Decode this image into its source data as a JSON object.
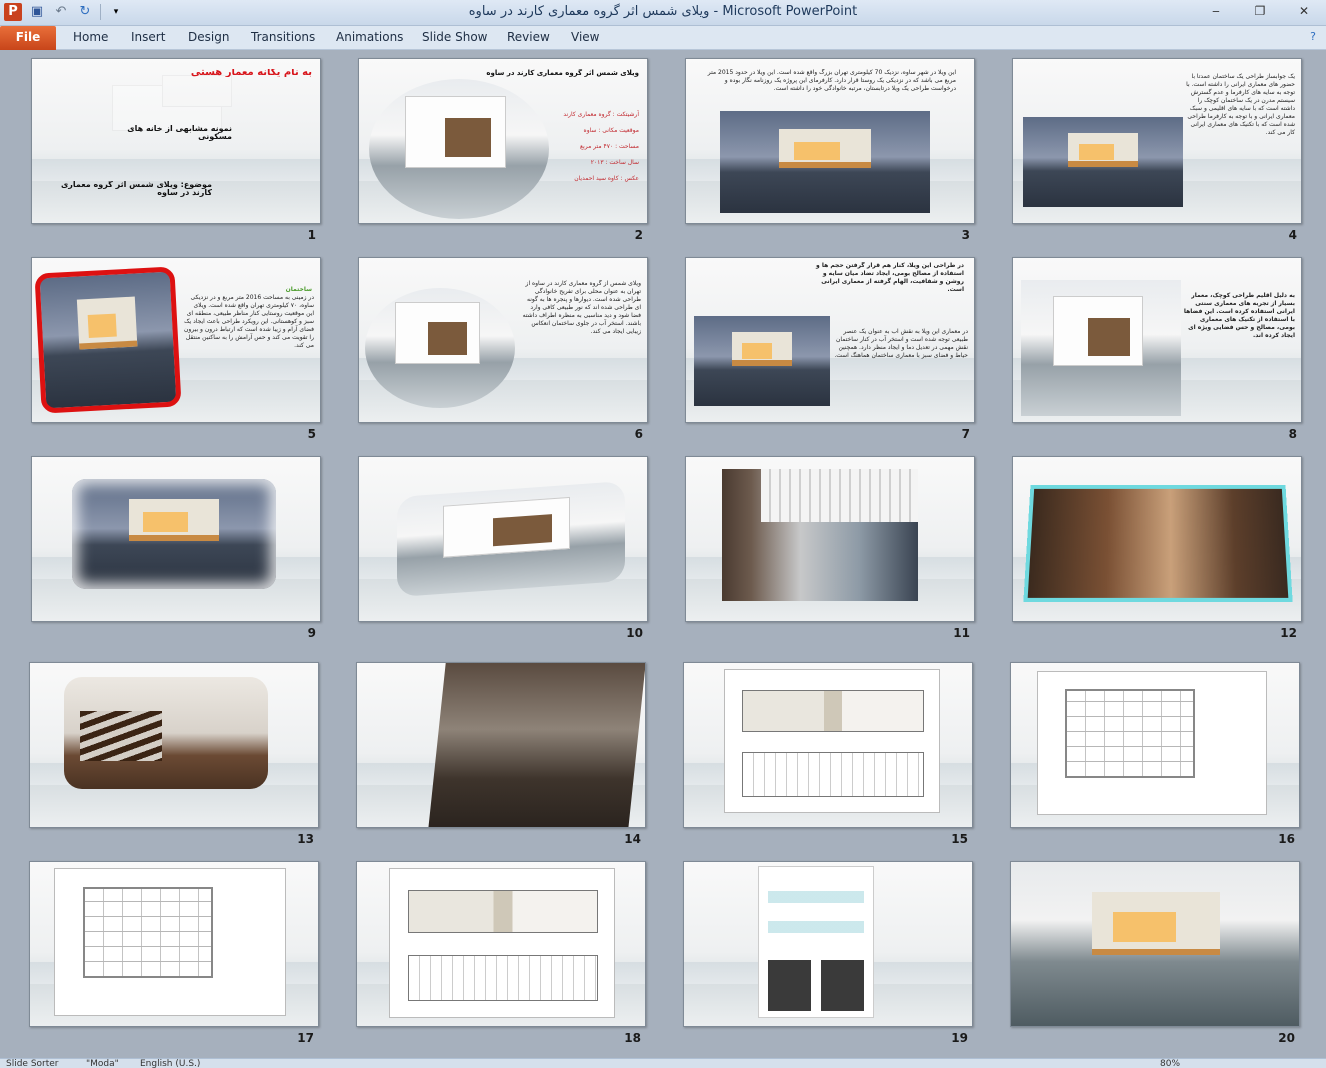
{
  "window": {
    "title": "ویلای شمس اثر گروه معماری کارند در ساوه  -  Microsoft PowerPoint",
    "app_icon": "P",
    "controls": [
      "‒",
      "❐",
      "✕"
    ]
  },
  "ribbon": {
    "file_tab": "File",
    "tabs": [
      "Home",
      "Insert",
      "Design",
      "Transitions",
      "Animations",
      "Slide Show",
      "Review",
      "View"
    ]
  },
  "slides": {
    "s1": {
      "number": "1",
      "heading": "به نام یگانه معمار هستی",
      "subtitle": "نمونه مشابهی از خانه های مسکونی",
      "topic": "موضوع: ویلای شمس اثر گروه معماری کارند در ساوه"
    },
    "s2": {
      "number": "2",
      "title": "ویلای شمس اثر گروه معماری کارند در ساوه",
      "details": [
        "آرشیتکت : گروه معماری کارند",
        "موقعیت مکانی : ساوه",
        "مساحت : ۴۷۰ متر مربع",
        "سال ساخت : ۲۰۱۳",
        "عکس : کاوه سید احمدیان"
      ]
    },
    "s3": {
      "number": "3",
      "text": "این ویلا در شهر ساوه، نزدیک 70 کیلومتری تهران بزرگ واقع شده است. این ویلا در حدود 2015 متر مربع می باشد که در نزدیکی یک روستا قرار دارد. کارفرمای این پروژه یک روزنامه نگار بوده و درخواست طراحی یک ویلا درتابستان، مرتبه خانوادگی خود را داشته است."
    },
    "s4": {
      "number": "4",
      "text": "یک جوابساز طراحی یک ساختمان عمدتاً با حضور های معماری ایرانی را داشته است. با توجه به سایه های کارفرما و عدم گسترش سیستم مدرن در یک ساختمان کوچک را داشته است که با سایه های اقلیمی و سبک معماری ایرانی و با توجه به کارفرما طراحی شده است که با تکنیک های معماری ایرانی کار می کند."
    },
    "s5": {
      "number": "5",
      "highlight": "ساختمان",
      "text": "در زمینی به مساحت 2016 متر مربع و در نزدیکی ساوه، ۷۰ کیلومتری تهران واقع شده است. ویلای این موقعیت روستایی کنار مناظر طبیعی، منطقه ای سبز و کوهستانی. این رویکرد طراحی باعث ایجاد یک فضای آرام و زیبا شده است که ارتباط درون و بیرون را تقویت می کند و حس آرامش را به ساکنین منتقل می کند."
    },
    "s6": {
      "number": "6",
      "text": "ویلای شمس از گروه معماری کارند در ساوه از تهران به عنوان محلی برای تفریح خانوادگی طراحی شده است. دیوارها و پنجره ها به گونه ای طراحی شده اند که نور طبیعی کافی وارد فضا شود و دید مناسبی به منظره اطراف داشته باشند. استخر آب در جلوی ساختمان انعکاس زیبایی ایجاد می کند."
    },
    "s7": {
      "number": "7",
      "text_top": "در طراحی این ویلا، کنار هم قرار گرفتن حجم ها و استفاده از مصالح بومی، ایجاد تضاد میان سایه و روشن و شفافیت، الهام گرفته از معماری ایرانی است.",
      "text_bottom": "در معماری این ویلا به نقش آب به عنوان یک عنصر طبیعی توجه شده است و استخر آب در کنار ساختمان نقش مهمی در تعدیل دما و ایجاد منظر دارد. همچنین حیاط و فضای سبز با معماری ساختمان هماهنگ است."
    },
    "s8": {
      "number": "8",
      "text": "به دلیل اقلیم طراحی کوچک، معمار بسیار از تجربه های معماری سنتی ایرانی استفاده کرده است. این فضاها با استفاده از تکنیک های معماری بومی، مصالح و حس فضایی ویژه ای ایجاد کرده اند."
    },
    "s9": {
      "number": "9"
    },
    "s10": {
      "number": "10"
    },
    "s11": {
      "number": "11"
    },
    "s12": {
      "number": "12"
    },
    "s13": {
      "number": "13"
    },
    "s14": {
      "number": "14"
    },
    "s15": {
      "number": "15"
    },
    "s16": {
      "number": "16"
    },
    "s17": {
      "number": "17"
    },
    "s18": {
      "number": "18"
    },
    "s19": {
      "number": "19"
    },
    "s20": {
      "number": "20"
    }
  },
  "statusbar": {
    "view": "Slide Sorter",
    "theme": "\"Moda\"",
    "language": "English (U.S.)",
    "zoom": "80%"
  },
  "colors": {
    "file_tab": "#c8451a",
    "workspace": "#a6b0bd",
    "slide_title_red": "#d8151b"
  },
  "icons": {
    "app": "powerpoint-icon",
    "save": "save-icon",
    "undo": "undo-icon",
    "redo": "redo-icon",
    "help": "help-icon"
  }
}
